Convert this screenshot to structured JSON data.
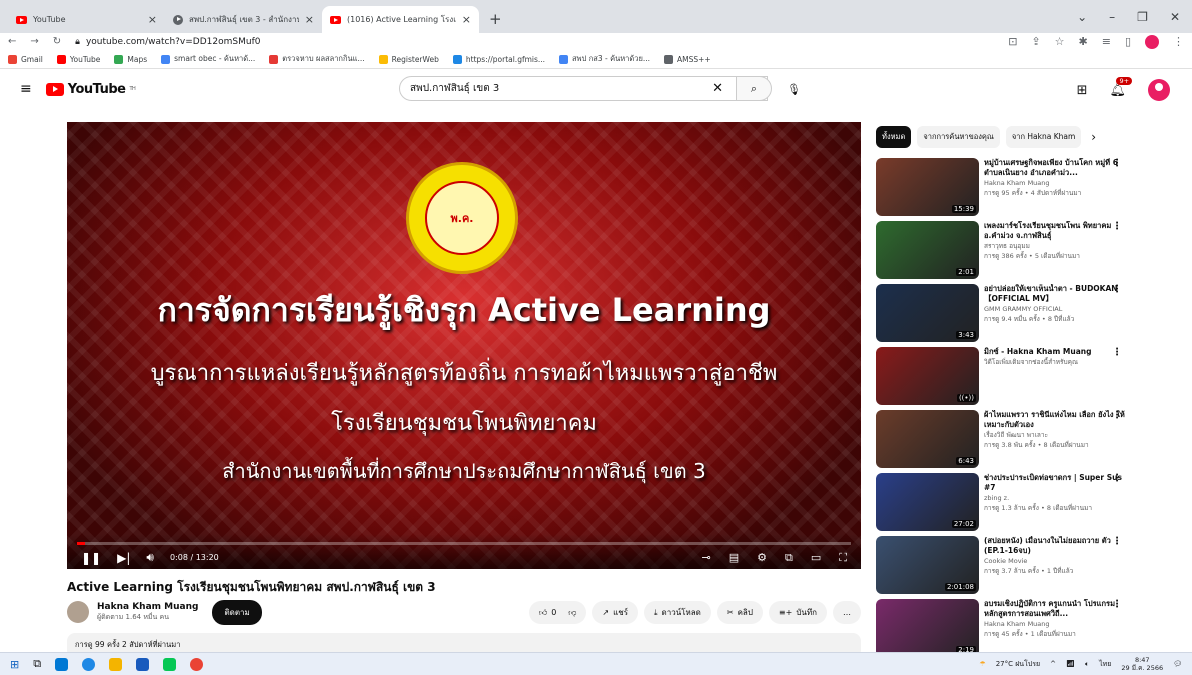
{
  "browser": {
    "tabs": [
      {
        "title": "YouTube",
        "close": "×",
        "icon": "youtube-icon",
        "active": false
      },
      {
        "title": "สพป.กาฬสินธุ์ เขต 3 - สำนักงานเขตพื้",
        "close": "×",
        "icon": "globe-icon",
        "active": false
      },
      {
        "title": "(1016) Active Learning โรงเรีย",
        "close": "×",
        "icon": "youtube-icon",
        "active": true
      }
    ],
    "new_tab": "+",
    "url": "youtube.com/watch?v=DD12omSMuf0",
    "bookmarks": [
      {
        "label": "Gmail",
        "color": "#ea4335"
      },
      {
        "label": "YouTube",
        "color": "#ff0000"
      },
      {
        "label": "Maps",
        "color": "#34a853"
      },
      {
        "label": "smart obec - ค้นหาด้...",
        "color": "#4285f4"
      },
      {
        "label": "ตรวจหาบ ผลสลากกินแ...",
        "color": "#e53935"
      },
      {
        "label": "RegisterWeb",
        "color": "#fbbc05"
      },
      {
        "label": "https://portal.gfmis...",
        "color": "#1e88e5"
      },
      {
        "label": "สพป กส3 - ค้นหาด้วย...",
        "color": "#4285f4"
      },
      {
        "label": "AMSS++",
        "color": "#5f6368"
      }
    ]
  },
  "youtube": {
    "logo": "YouTube",
    "logo_sup": "TH",
    "search_value": "สพป.กาฬสินธุ์ เขต 3",
    "notif_count": "9+"
  },
  "video": {
    "line1": "การจัดการเรียนรู้เชิงรุก Active Learning",
    "line2": "บูรณาการแหล่งเรียนรู้หลักสูตรท้องถิ่น การทอผ้าไหมแพรวาสู่อาชีพ",
    "line3": "โรงเรียนชุมชนโพนพิทยาคม",
    "line4": "สำนักงานเขตพื้นที่การศึกษาประถมศึกษากาฬสินธุ์ เขต 3",
    "seal_text": "พ.ค.",
    "time": "0:08 / 13:20",
    "progress": 0.01,
    "title": "Active Learning โรงเรียนชุมชนโพนพิทยาคม สพป.กาฬสินธุ์ เขต 3",
    "channel": "Hakna Kham Muang",
    "subs": "ผู้ติดตาม 1.64 หมื่น คน",
    "subscribe": "ติดตาม",
    "likes": "0",
    "share": "แชร์",
    "download": "ดาวน์โหลด",
    "clip": "คลิป",
    "save": "บันทึก",
    "more": "…",
    "desc": "การดู 99 ครั้ง  2 สัปดาห์ที่ผ่านมา"
  },
  "sidebar": {
    "chips": [
      "ทั้งหมด",
      "จากการค้นหาของคุณ",
      "จาก Hakna Kham"
    ],
    "next": "›",
    "items": [
      {
        "title": "หมู่บ้านเศรษฐกิจพอเพียง บ้านโคก หมู่ที่ 6 ตำบลเนินยาง อำเภอคำม่ว...",
        "channel": "Hakna Kham Muang",
        "meta": "การดู 95 ครั้ง • 4 สัปดาห์ที่ผ่านมา",
        "dur": "15:39",
        "color": "#7a3b2a"
      },
      {
        "title": "เพลงมาร์ชโรงเรียนชุมชนโพน พิทยาคม อ.คำม่วง จ.กาฬสินธุ์",
        "channel": "สราวุทธ อนุอุมม",
        "meta": "การดู 386 ครั้ง • 5 เดือนที่ผ่านมา",
        "dur": "2:01",
        "color": "#2e6b2e"
      },
      {
        "title": "อย่าปล่อยให้เขาเห็นน้ำตา - BUDOKAN 【OFFICIAL MV】",
        "channel": "GMM GRAMMY OFFICIAL",
        "meta": "การดู 9.4 หมื่น ครั้ง • 8 ปีที่แล้ว",
        "dur": "3:43",
        "color": "#1c2f4d"
      },
      {
        "title": "มิกซ์ - Hakna Kham Muang",
        "channel": "วิดีโอเพิ่มเติมจากช่องนี้สำหรับคุณ",
        "meta": "",
        "dur": "",
        "color": "#8a1a1a"
      },
      {
        "title": "ผ้าไหมแพรวา ราชินีแห่งไหม เลือก ยังไง ให้เหมาะกับตัวเอง",
        "channel": "เรื่องวิถี พัฒนา พาเลาะ",
        "meta": "การดู 3.8 พัน ครั้ง • 8 เดือนที่ผ่านมา",
        "dur": "6:43",
        "color": "#6b3c2a"
      },
      {
        "title": "ช่างประปาระเบิดท่อขาดกร | Super Sus #7",
        "channel": "zbing z.",
        "meta": "การดู 1.3 ล้าน ครั้ง • 8 เดือนที่ผ่านมา",
        "dur": "27:02",
        "color": "#2a3f8a"
      },
      {
        "title": "(สปอยหนัง) เมื่อนางในไม่ยอมถวาย ตัว (EP.1-16จบ)",
        "channel": "Cookie Movie",
        "meta": "การดู 3.7 ล้าน ครั้ง • 1 ปีที่แล้ว",
        "dur": "2:01:08",
        "color": "#3a5070"
      },
      {
        "title": "อบรมเชิงปฏิบัติการ ครูแกนนำ โปรแกรมหลักสูตรการสอนเพศวิถี...",
        "channel": "Hakna Kham Muang",
        "meta": "การดู 45 ครั้ง • 1 เดือนที่ผ่านมา",
        "dur": "2:19",
        "color": "#7a2a6a"
      }
    ]
  },
  "taskbar": {
    "weather": "27°C ฝนโปรย",
    "lang": "ไทย",
    "time": "8:47",
    "date": "29 มี.ค. 2566"
  }
}
